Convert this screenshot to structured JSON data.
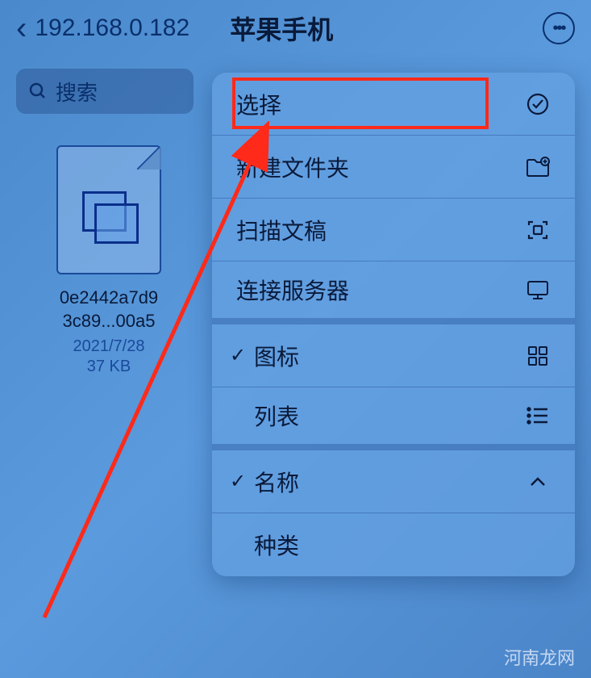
{
  "nav": {
    "back_label": "192.168.0.182",
    "title": "苹果手机"
  },
  "search": {
    "placeholder": "搜索"
  },
  "file": {
    "name_line1": "0e2442a7d9",
    "name_line2": "3c89...00a5",
    "date": "2021/7/28",
    "size": "37 KB"
  },
  "menu": {
    "select": "选择",
    "new_folder": "新建文件夹",
    "scan_document": "扫描文稿",
    "connect_server": "连接服务器",
    "icon_view": "图标",
    "list_view": "列表",
    "sort_name": "名称",
    "sort_kind": "种类"
  },
  "watermark": "河南龙网"
}
